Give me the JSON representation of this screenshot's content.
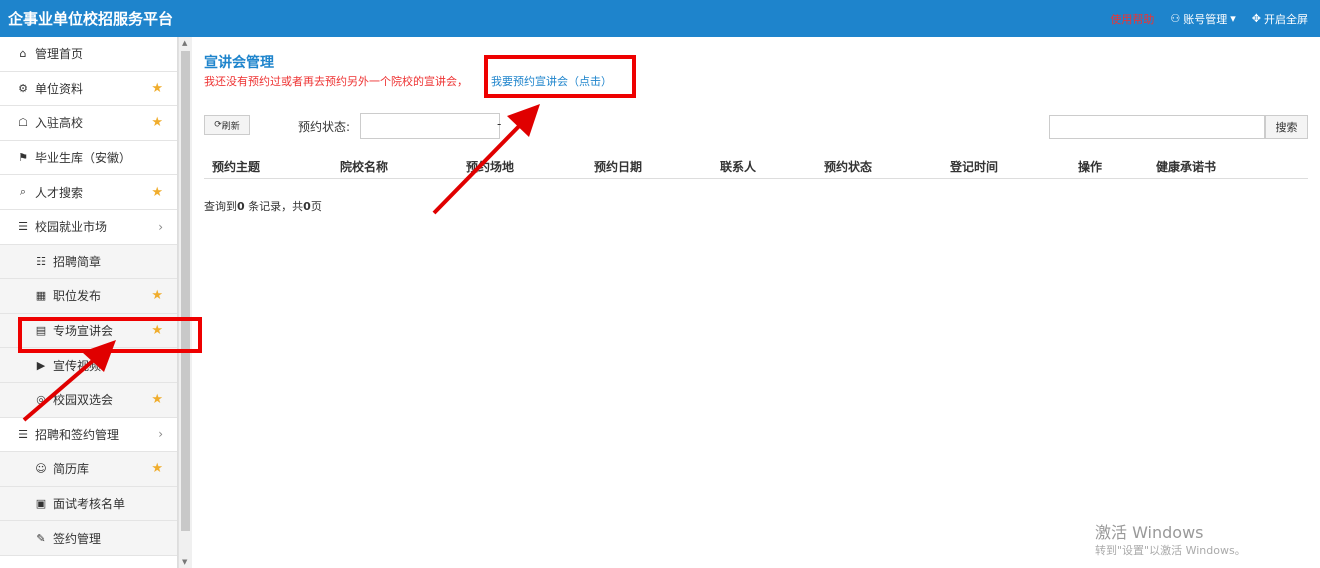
{
  "header": {
    "title": "企事业单位校招服务平台",
    "help": "使用帮助",
    "account": "账号管理",
    "fullscreen": "开启全屏"
  },
  "sidebar": {
    "items": [
      {
        "label": "管理首页",
        "icon": "home-icon",
        "star": false,
        "chevron": false,
        "sub": false
      },
      {
        "label": "单位资料",
        "icon": "gear-icon",
        "star": true,
        "chevron": false,
        "sub": false
      },
      {
        "label": "入驻高校",
        "icon": "bank-icon",
        "star": true,
        "chevron": false,
        "sub": false
      },
      {
        "label": "毕业生库（安徽）",
        "icon": "graduation-cap-icon",
        "star": false,
        "chevron": false,
        "sub": false
      },
      {
        "label": "人才搜索",
        "icon": "search-icon",
        "star": true,
        "chevron": false,
        "sub": false
      },
      {
        "label": "校园就业市场",
        "icon": "list-icon",
        "star": false,
        "chevron": true,
        "sub": false
      },
      {
        "label": "招聘简章",
        "icon": "document-icon",
        "star": false,
        "chevron": false,
        "sub": true
      },
      {
        "label": "职位发布",
        "icon": "grid-icon",
        "star": true,
        "chevron": false,
        "sub": true
      },
      {
        "label": "专场宣讲会",
        "icon": "presentation-icon",
        "star": true,
        "chevron": false,
        "sub": true
      },
      {
        "label": "宣传视频",
        "icon": "video-icon",
        "star": false,
        "chevron": false,
        "sub": true
      },
      {
        "label": "校园双选会",
        "icon": "network-icon",
        "star": true,
        "chevron": false,
        "sub": true
      },
      {
        "label": "招聘和签约管理",
        "icon": "list-icon",
        "star": false,
        "chevron": true,
        "sub": false
      },
      {
        "label": "简历库",
        "icon": "users-icon",
        "star": true,
        "chevron": false,
        "sub": true
      },
      {
        "label": "面试考核名单",
        "icon": "calendar-icon",
        "star": false,
        "chevron": false,
        "sub": true
      },
      {
        "label": "签约管理",
        "icon": "edit-icon",
        "star": false,
        "chevron": false,
        "sub": true
      }
    ]
  },
  "main": {
    "title": "宣讲会管理",
    "notice": "我还没有预约过或者再去预约另外一个院校的宣讲会，",
    "notice_link": "我要预约宣讲会（点击）",
    "refresh": "刷新",
    "status_label": "预约状态:",
    "status_value": "",
    "dash": "-",
    "search_value": "",
    "search_button": "搜索",
    "columns": [
      "预约主题",
      "院校名称",
      "预约场地",
      "预约日期",
      "联系人",
      "预约状态",
      "登记时间",
      "操作",
      "健康承诺书"
    ],
    "record_prefix": "查询到",
    "record_count": "0",
    "record_mid": "条记录，共",
    "record_pages": "0",
    "record_suffix": "页"
  },
  "watermark": {
    "line1": "激活 Windows",
    "line2": "转到\"设置\"以激活 Windows。"
  },
  "colors": {
    "accent": "#1e84cc",
    "annotation": "#e00000",
    "star": "#f0ad2d"
  }
}
